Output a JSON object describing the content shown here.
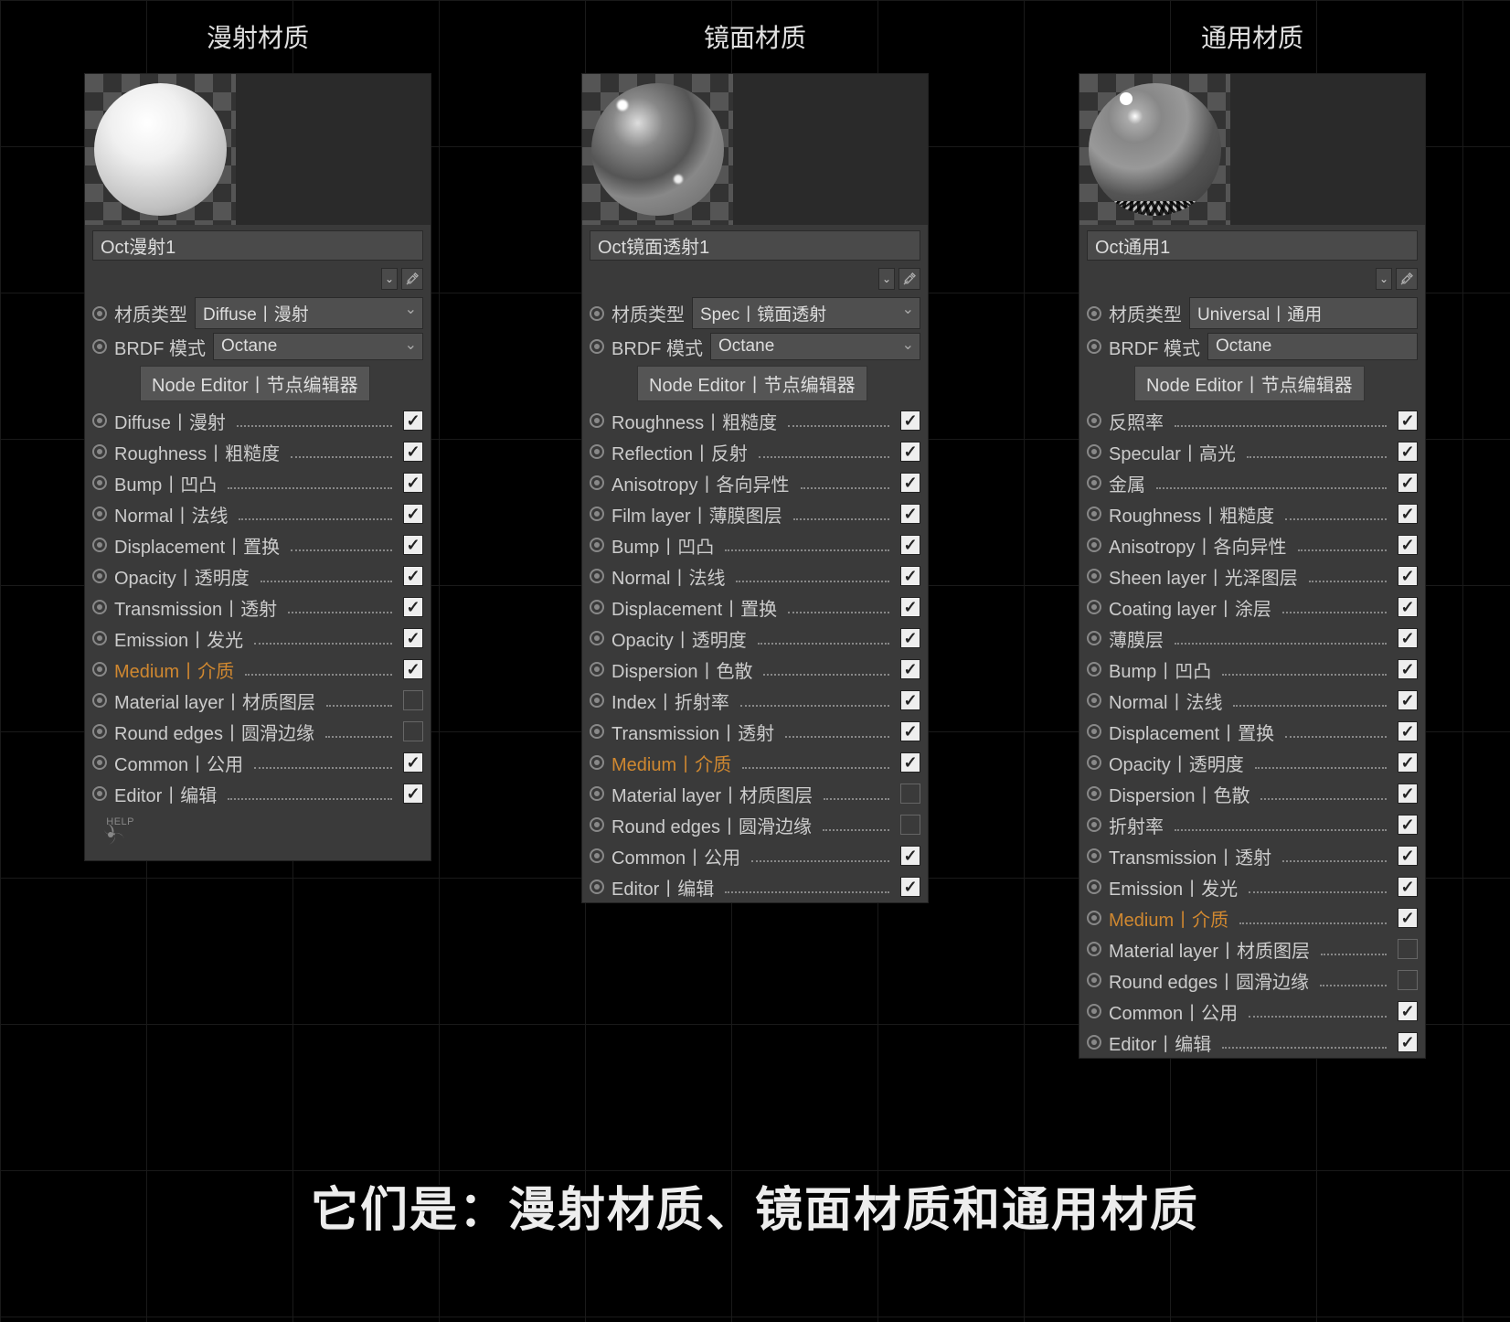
{
  "caption": "它们是：漫射材质、镜面材质和通用材质",
  "columns": [
    {
      "title": "漫射材质",
      "name": "Oct漫射1",
      "sphere": "diffuse",
      "type_label": "材质类型",
      "type_value": "Diffuse丨漫射",
      "brdf_label": "BRDF 模式",
      "brdf_value": "Octane",
      "node_btn": "Node Editor丨节点编辑器",
      "items": [
        {
          "label": "Diffuse丨漫射",
          "checked": true,
          "hl": false
        },
        {
          "label": "Roughness丨粗糙度",
          "checked": true,
          "hl": false
        },
        {
          "label": "Bump丨凹凸",
          "checked": true,
          "hl": false
        },
        {
          "label": "Normal丨法线",
          "checked": true,
          "hl": false
        },
        {
          "label": "Displacement丨置换",
          "checked": true,
          "hl": false
        },
        {
          "label": "Opacity丨透明度",
          "checked": true,
          "hl": false
        },
        {
          "label": "Transmission丨透射",
          "checked": true,
          "hl": false
        },
        {
          "label": "Emission丨发光",
          "checked": true,
          "hl": false
        },
        {
          "label": "Medium丨介质",
          "checked": true,
          "hl": true
        },
        {
          "label": "Material layer丨材质图层",
          "checked": false,
          "hl": false
        },
        {
          "label": "Round edges丨圆滑边缘",
          "checked": false,
          "hl": false
        },
        {
          "label": "Common丨公用",
          "checked": true,
          "hl": false
        },
        {
          "label": "Editor丨编辑",
          "checked": true,
          "hl": false
        }
      ],
      "show_help": true,
      "show_chevrons": true
    },
    {
      "title": "镜面材质",
      "name": "Oct镜面透射1",
      "sphere": "specular",
      "type_label": "材质类型",
      "type_value": "Spec丨镜面透射",
      "brdf_label": "BRDF 模式",
      "brdf_value": "Octane",
      "node_btn": "Node Editor丨节点编辑器",
      "items": [
        {
          "label": "Roughness丨粗糙度",
          "checked": true,
          "hl": false
        },
        {
          "label": "Reflection丨反射",
          "checked": true,
          "hl": false
        },
        {
          "label": "Anisotropy丨各向异性",
          "checked": true,
          "hl": false
        },
        {
          "label": "Film layer丨薄膜图层",
          "checked": true,
          "hl": false
        },
        {
          "label": "Bump丨凹凸",
          "checked": true,
          "hl": false
        },
        {
          "label": "Normal丨法线",
          "checked": true,
          "hl": false
        },
        {
          "label": "Displacement丨置换",
          "checked": true,
          "hl": false
        },
        {
          "label": "Opacity丨透明度",
          "checked": true,
          "hl": false
        },
        {
          "label": "Dispersion丨色散",
          "checked": true,
          "hl": false
        },
        {
          "label": "Index丨折射率",
          "checked": true,
          "hl": false
        },
        {
          "label": "Transmission丨透射",
          "checked": true,
          "hl": false
        },
        {
          "label": "Medium丨介质",
          "checked": true,
          "hl": true
        },
        {
          "label": "Material layer丨材质图层",
          "checked": false,
          "hl": false
        },
        {
          "label": "Round edges丨圆滑边缘",
          "checked": false,
          "hl": false
        },
        {
          "label": "Common丨公用",
          "checked": true,
          "hl": false
        },
        {
          "label": "Editor丨编辑",
          "checked": true,
          "hl": false
        }
      ],
      "show_help": false,
      "show_chevrons": true
    },
    {
      "title": "通用材质",
      "name": "Oct通用1",
      "sphere": "universal",
      "type_label": "材质类型",
      "type_value": "Universal丨通用",
      "brdf_label": "BRDF 模式",
      "brdf_value": "Octane",
      "node_btn": "Node Editor丨节点编辑器",
      "items": [
        {
          "label": "反照率",
          "checked": true,
          "hl": false
        },
        {
          "label": "Specular丨高光",
          "checked": true,
          "hl": false
        },
        {
          "label": "金属",
          "checked": true,
          "hl": false
        },
        {
          "label": "Roughness丨粗糙度",
          "checked": true,
          "hl": false
        },
        {
          "label": "Anisotropy丨各向异性",
          "checked": true,
          "hl": false
        },
        {
          "label": "Sheen layer丨光泽图层",
          "checked": true,
          "hl": false
        },
        {
          "label": "Coating layer丨涂层",
          "checked": true,
          "hl": false
        },
        {
          "label": "薄膜层",
          "checked": true,
          "hl": false
        },
        {
          "label": "Bump丨凹凸",
          "checked": true,
          "hl": false
        },
        {
          "label": "Normal丨法线",
          "checked": true,
          "hl": false
        },
        {
          "label": "Displacement丨置换",
          "checked": true,
          "hl": false
        },
        {
          "label": "Opacity丨透明度",
          "checked": true,
          "hl": false
        },
        {
          "label": "Dispersion丨色散",
          "checked": true,
          "hl": false
        },
        {
          "label": "折射率",
          "checked": true,
          "hl": false
        },
        {
          "label": "Transmission丨透射",
          "checked": true,
          "hl": false
        },
        {
          "label": "Emission丨发光",
          "checked": true,
          "hl": false
        },
        {
          "label": "Medium丨介质",
          "checked": true,
          "hl": true
        },
        {
          "label": "Material layer丨材质图层",
          "checked": false,
          "hl": false
        },
        {
          "label": "Round edges丨圆滑边缘",
          "checked": false,
          "hl": false
        },
        {
          "label": "Common丨公用",
          "checked": true,
          "hl": false
        },
        {
          "label": "Editor丨编辑",
          "checked": true,
          "hl": false
        }
      ],
      "show_help": false,
      "show_chevrons": false
    }
  ],
  "help_text": "HELP"
}
